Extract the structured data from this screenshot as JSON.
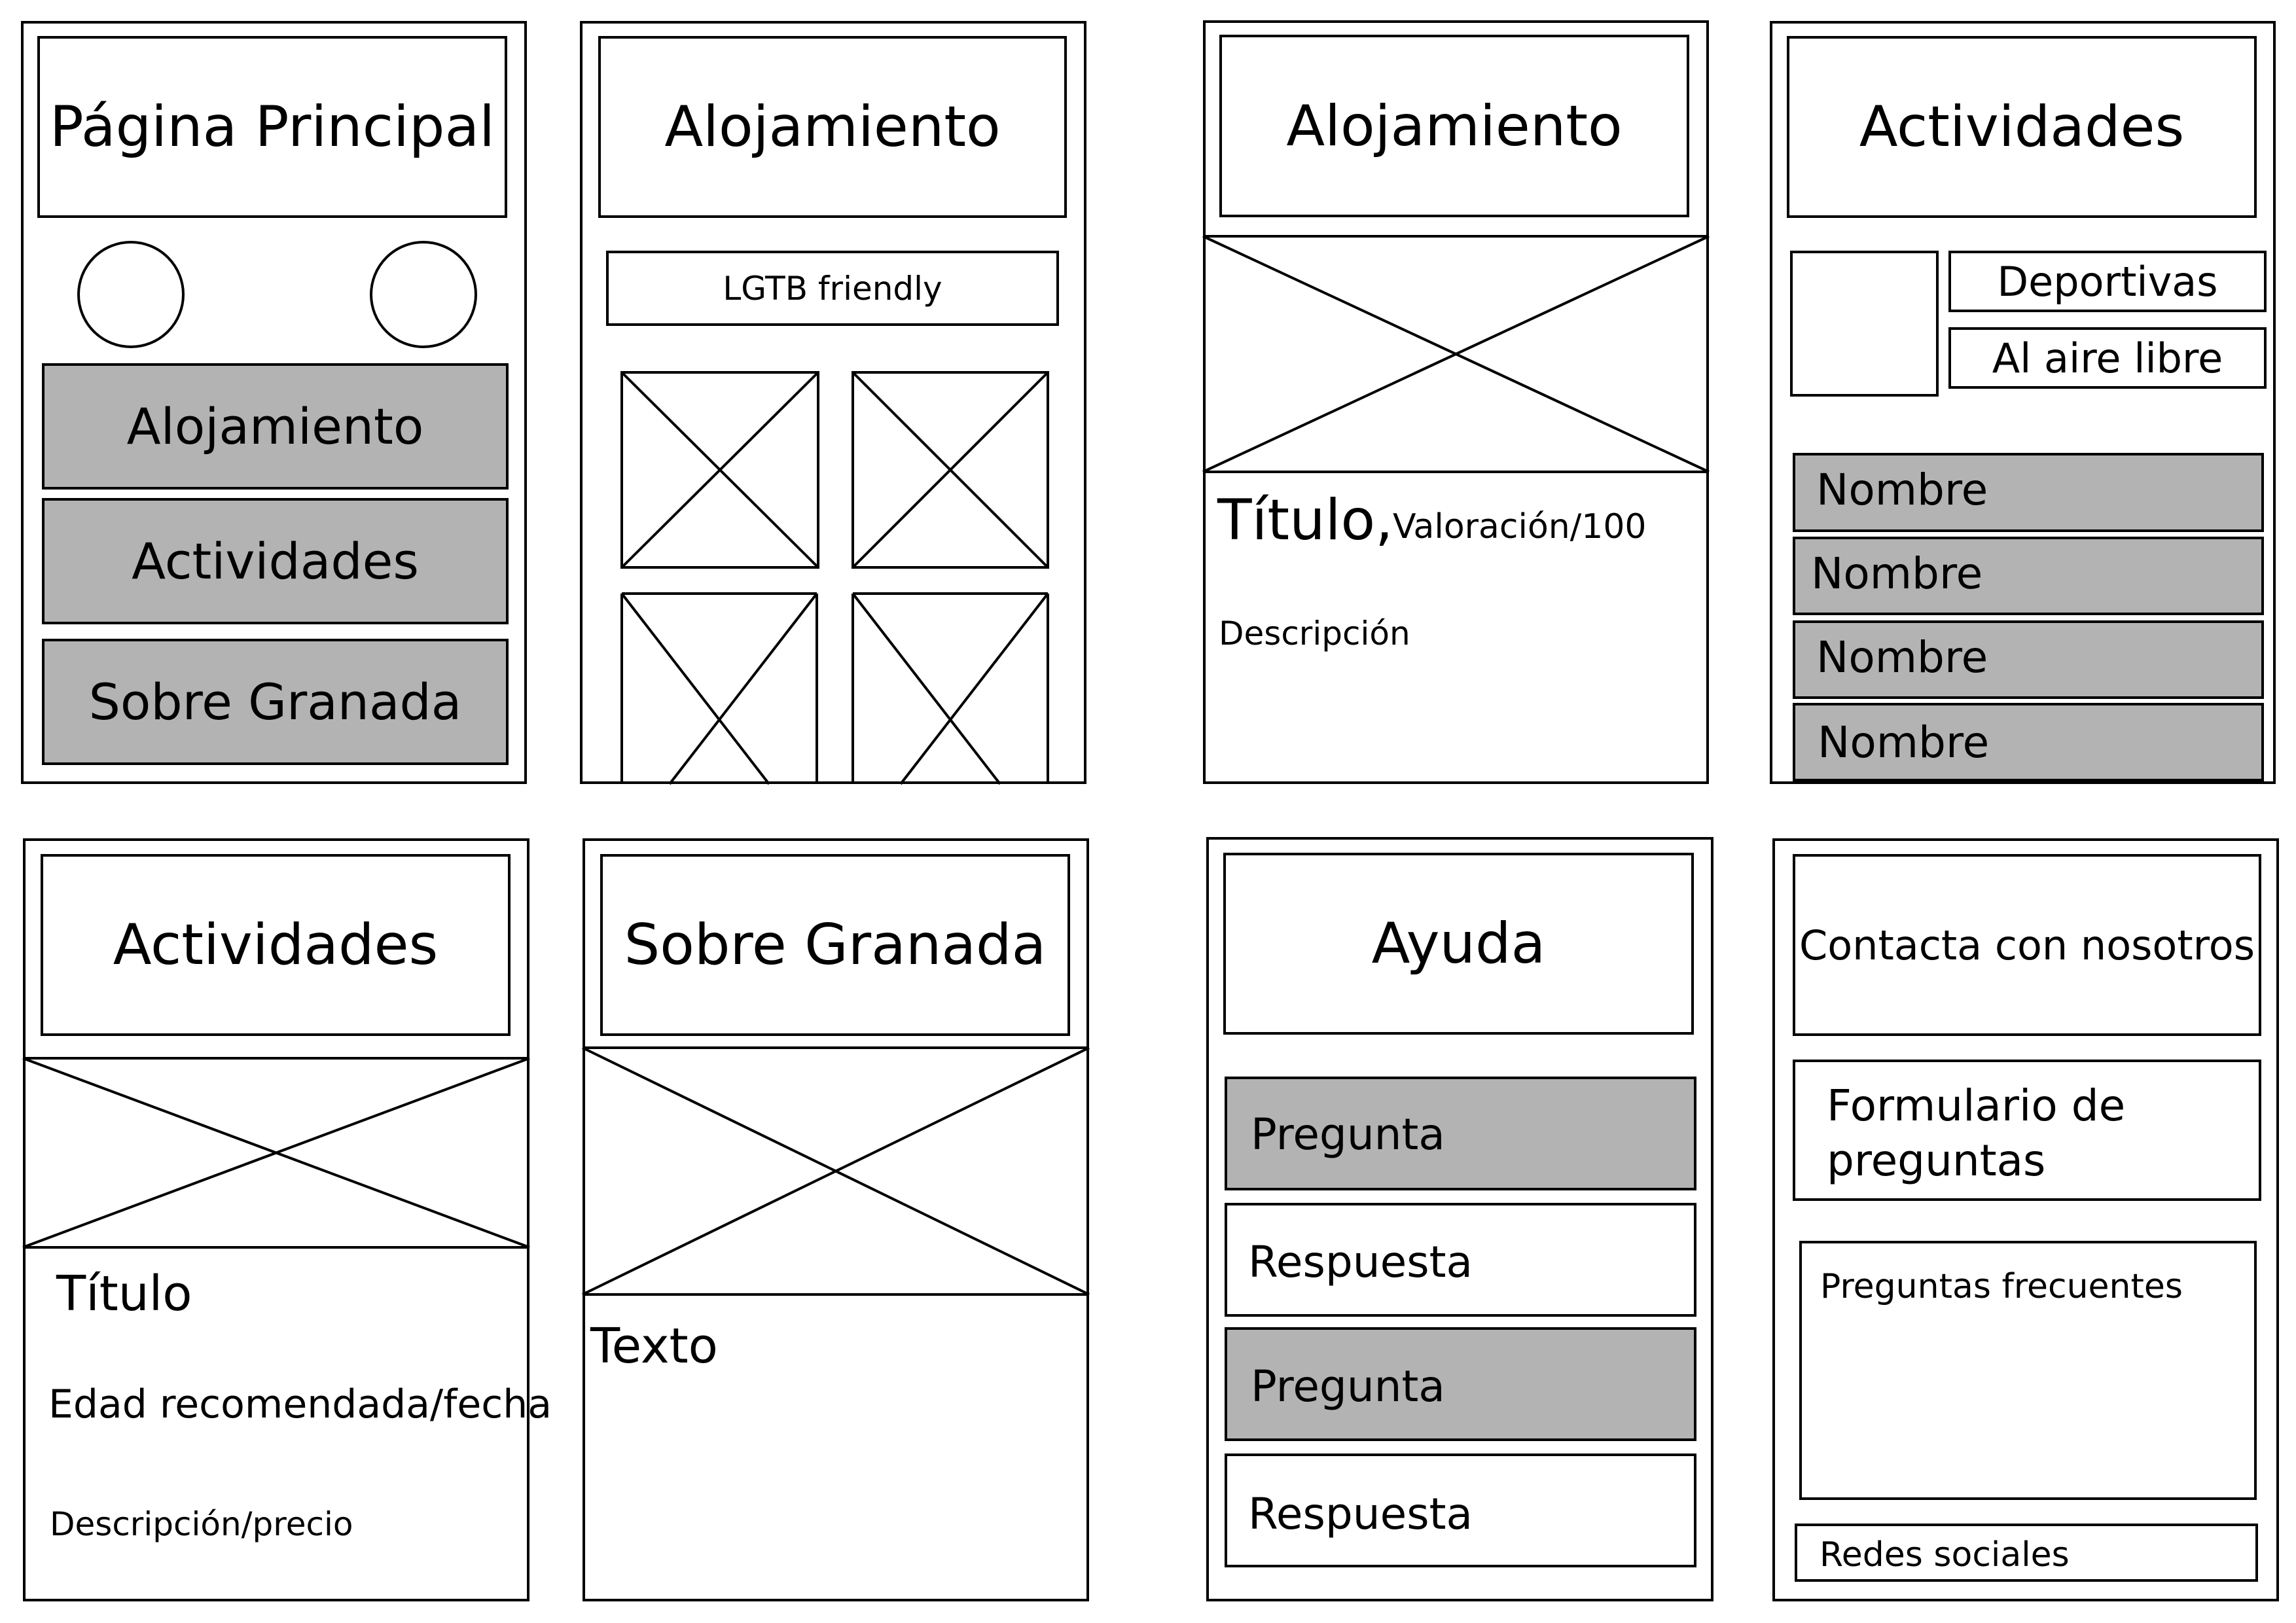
{
  "screens": {
    "home": {
      "title": "Página Principal",
      "menu": [
        "Alojamiento",
        "Actividades",
        "Sobre Granada"
      ]
    },
    "accommodation_list": {
      "title": "Alojamiento",
      "filter": "LGTB friendly"
    },
    "accommodation_detail": {
      "title": "Alojamiento",
      "item_title": "Título,",
      "rating": "Valoración/100",
      "description": "Descripción"
    },
    "activities_list": {
      "title": "Actividades",
      "filters": [
        "Deportivas",
        "Al aire libre"
      ],
      "items": [
        "Nombre",
        "Nombre",
        "Nombre",
        "Nombre"
      ]
    },
    "activity_detail": {
      "title": "Actividades",
      "item_title": "Título",
      "age_date": "Edad recomendada/fecha",
      "description_price": "Descripción/precio"
    },
    "about_granada": {
      "title": "Sobre Granada",
      "text": "Texto"
    },
    "help": {
      "title": "Ayuda",
      "faq": [
        {
          "question": "Pregunta",
          "answer": "Respuesta"
        },
        {
          "question": "Pregunta",
          "answer": "Respuesta"
        }
      ]
    },
    "contact": {
      "title": "Contacta con nosotros",
      "form_line1": "Formulario de",
      "form_line2": "preguntas",
      "faq_label": "Preguntas frecuentes",
      "social": "Redes sociales"
    }
  },
  "colors": {
    "stroke": "#000000",
    "highlight_fill": "#b3b3b3",
    "background": "#ffffff"
  }
}
